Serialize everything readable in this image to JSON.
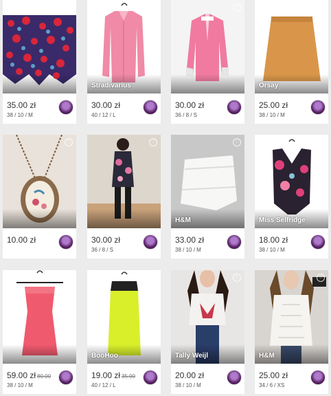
{
  "listings": [
    {
      "price": "35.00 zł",
      "old_price": "",
      "size": "38 / 10 / M",
      "brand": ""
    },
    {
      "price": "30.00 zł",
      "old_price": "",
      "size": "40 / 12 / L",
      "brand": "Stradivarius"
    },
    {
      "price": "30.00 zł",
      "old_price": "",
      "size": "36 / 8 / S",
      "brand": ""
    },
    {
      "price": "25.00 zł",
      "old_price": "",
      "size": "38 / 10 / M",
      "brand": "Orsay"
    },
    {
      "price": "10.00 zł",
      "old_price": "",
      "size": "",
      "brand": ""
    },
    {
      "price": "30.00 zł",
      "old_price": "",
      "size": "36 / 8 / S",
      "brand": ""
    },
    {
      "price": "33.00 zł",
      "old_price": "",
      "size": "38 / 10 / M",
      "brand": "H&M"
    },
    {
      "price": "18.00 zł",
      "old_price": "",
      "size": "38 / 10 / M",
      "brand": "Miss Selfridge"
    },
    {
      "price": "59.00 zł",
      "old_price": "80.00",
      "size": "38 / 10 / M",
      "brand": ""
    },
    {
      "price": "19.00 zł",
      "old_price": "35.00",
      "size": "40 / 12 / L",
      "brand": "BooHoo"
    },
    {
      "price": "20.00 zł",
      "old_price": "",
      "size": "38 / 10 / M",
      "brand": "Tally Weijl"
    },
    {
      "price": "25.00 zł",
      "old_price": "",
      "size": "34 / 6 / XS",
      "brand": "H&M"
    }
  ],
  "icons": {
    "favorite": "heart-icon",
    "seller": "seller-avatar"
  }
}
